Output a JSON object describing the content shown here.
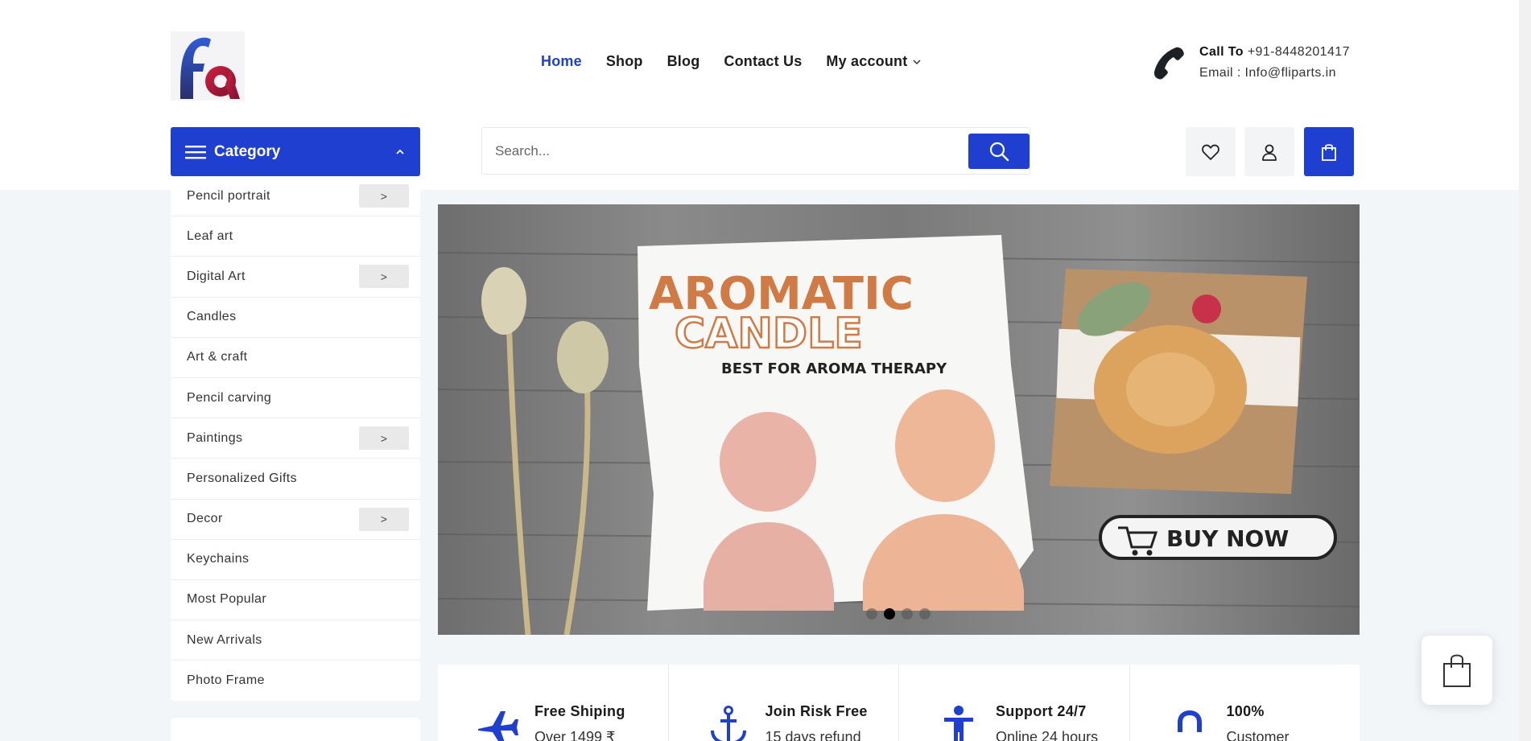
{
  "logo": {
    "text": "fa"
  },
  "nav": {
    "items": [
      {
        "label": "Home",
        "active": true
      },
      {
        "label": "Shop"
      },
      {
        "label": "Blog"
      },
      {
        "label": "Contact Us"
      },
      {
        "label": "My account",
        "has_dropdown": true
      }
    ]
  },
  "contact": {
    "call_label": "Call To",
    "phone": "+91-8448201417",
    "email_line": "Email : Info@fliparts.in"
  },
  "category": {
    "title": "Category",
    "items": [
      {
        "label": "Pencil portrait",
        "has_sub": true
      },
      {
        "label": "Leaf art",
        "has_sub": false
      },
      {
        "label": "Digital Art",
        "has_sub": true
      },
      {
        "label": "Candles",
        "has_sub": false
      },
      {
        "label": "Art & craft",
        "has_sub": false
      },
      {
        "label": "Pencil carving",
        "has_sub": false
      },
      {
        "label": "Paintings",
        "has_sub": true
      },
      {
        "label": "Personalized Gifts",
        "has_sub": false
      },
      {
        "label": "Decor",
        "has_sub": true
      },
      {
        "label": "Keychains",
        "has_sub": false
      },
      {
        "label": "Most Popular",
        "has_sub": false
      },
      {
        "label": "New Arrivals",
        "has_sub": false
      },
      {
        "label": "Photo Frame",
        "has_sub": false
      }
    ],
    "sub_arrow": ">"
  },
  "search": {
    "placeholder": "Search...",
    "value": ""
  },
  "banner": {
    "headline1": "AROMATIC",
    "headline2": "CANDLE",
    "tagline": "BEST FOR  AROMA THERAPY",
    "cta": "BUY NOW",
    "slides": 4,
    "active_slide": 2
  },
  "features": [
    {
      "icon": "airplane-icon",
      "title": "Free Shiping",
      "sub": "Over 1499 ₹"
    },
    {
      "icon": "anchor-icon",
      "title": "Join Risk Free",
      "sub": "15 days refund"
    },
    {
      "icon": "person-icon",
      "title": "Support 24/7",
      "sub": "Online 24 hours"
    },
    {
      "icon": "lock-icon",
      "title": "100%",
      "sub": "Customer"
    }
  ],
  "colors": {
    "brand": "#1f3fd0",
    "text": "#1d1d1f",
    "background": "#f3f6f9"
  }
}
